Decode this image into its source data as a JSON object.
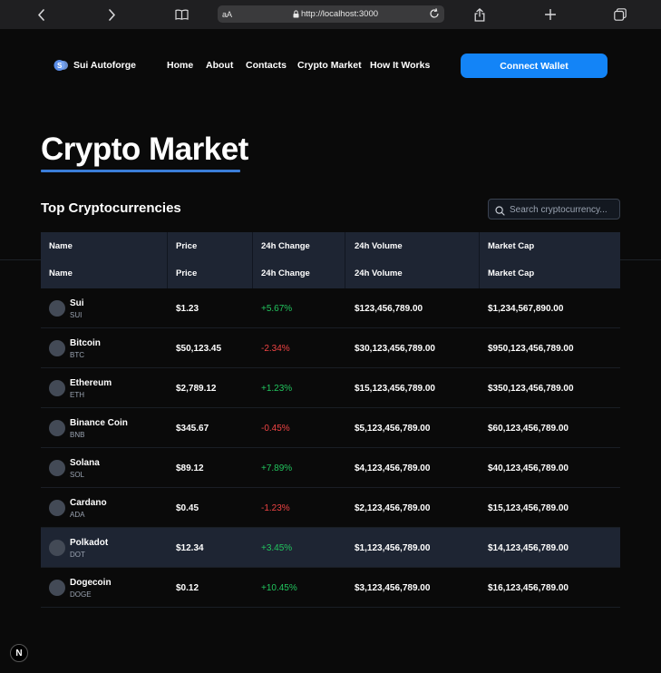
{
  "browser": {
    "text_size_label": "aA",
    "url": "http://localhost:3000"
  },
  "header": {
    "logo_text": "Sui Autoforge",
    "nav": [
      "Home",
      "About",
      "Contacts",
      "Crypto Market",
      "How It Works"
    ],
    "connect_label": "Connect Wallet"
  },
  "main": {
    "page_title": "Crypto Market",
    "section_title": "Top Cryptocurrencies",
    "search_placeholder": "Search cryptocurrency..."
  },
  "table": {
    "headers": [
      "Name",
      "Price",
      "24h Change",
      "24h Volume",
      "Market Cap"
    ],
    "rows": [
      {
        "name": "Sui",
        "symbol": "SUI",
        "price": "$1.23",
        "change": "+5.67%",
        "direction": "up",
        "volume": "$123,456,789.00",
        "market_cap": "$1,234,567,890.00"
      },
      {
        "name": "Bitcoin",
        "symbol": "BTC",
        "price": "$50,123.45",
        "change": "-2.34%",
        "direction": "down",
        "volume": "$30,123,456,789.00",
        "market_cap": "$950,123,456,789.00"
      },
      {
        "name": "Ethereum",
        "symbol": "ETH",
        "price": "$2,789.12",
        "change": "+1.23%",
        "direction": "up",
        "volume": "$15,123,456,789.00",
        "market_cap": "$350,123,456,789.00"
      },
      {
        "name": "Binance Coin",
        "symbol": "BNB",
        "price": "$345.67",
        "change": "-0.45%",
        "direction": "down",
        "volume": "$5,123,456,789.00",
        "market_cap": "$60,123,456,789.00"
      },
      {
        "name": "Solana",
        "symbol": "SOL",
        "price": "$89.12",
        "change": "+7.89%",
        "direction": "up",
        "volume": "$4,123,456,789.00",
        "market_cap": "$40,123,456,789.00"
      },
      {
        "name": "Cardano",
        "symbol": "ADA",
        "price": "$0.45",
        "change": "-1.23%",
        "direction": "down",
        "volume": "$2,123,456,789.00",
        "market_cap": "$15,123,456,789.00"
      },
      {
        "name": "Polkadot",
        "symbol": "DOT",
        "price": "$12.34",
        "change": "+3.45%",
        "direction": "up",
        "volume": "$1,123,456,789.00",
        "market_cap": "$14,123,456,789.00",
        "highlighted": true
      },
      {
        "name": "Dogecoin",
        "symbol": "DOGE",
        "price": "$0.12",
        "change": "+10.45%",
        "direction": "up",
        "volume": "$3,123,456,789.00",
        "market_cap": "$16,123,456,789.00"
      }
    ]
  },
  "colors": {
    "accent": "#1384f7",
    "positive": "#22c55e",
    "negative": "#ef4444",
    "table_header_bg": "#1e2533",
    "underline": "#3b7dd8"
  },
  "badge": {
    "label": "N"
  }
}
